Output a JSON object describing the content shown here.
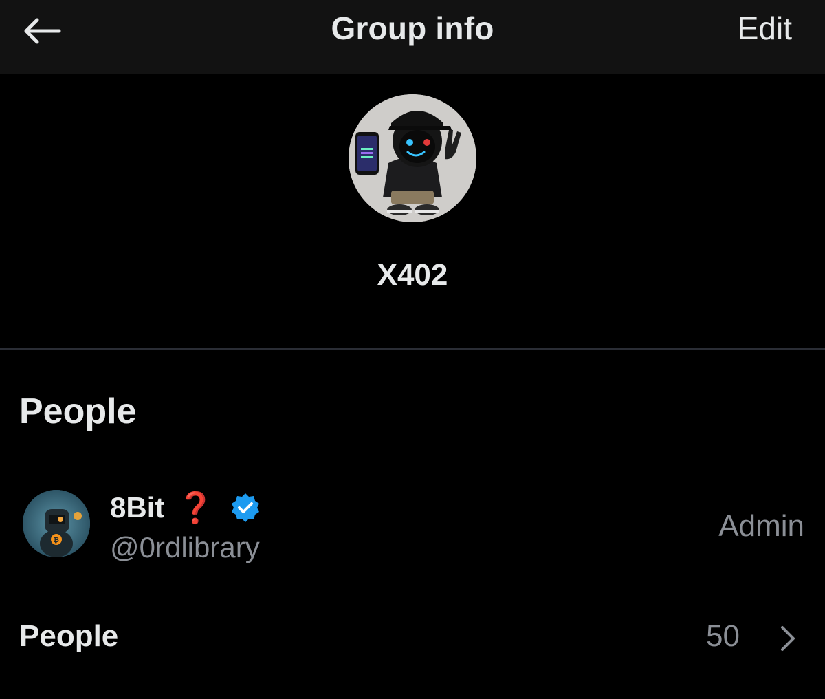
{
  "header": {
    "back_icon": "arrow-left-icon",
    "title": "Group info",
    "edit_label": "Edit"
  },
  "group": {
    "avatar_icon": "group-avatar",
    "name": "X402"
  },
  "people_section": {
    "title": "People",
    "members": [
      {
        "name": "8Bit",
        "emoji": "❓",
        "verified_icon": "verified-badge-icon",
        "handle": "@0rdlibrary",
        "role": "Admin"
      }
    ]
  },
  "people_row": {
    "label": "People",
    "count": "50",
    "chevron_icon": "chevron-right-icon"
  },
  "colors": {
    "background": "#000000",
    "header": "#121212",
    "text_primary": "#e7e9ea",
    "text_secondary": "#8b8f96",
    "verified_blue": "#1d9bf0",
    "question_red": "#e02b2b"
  }
}
